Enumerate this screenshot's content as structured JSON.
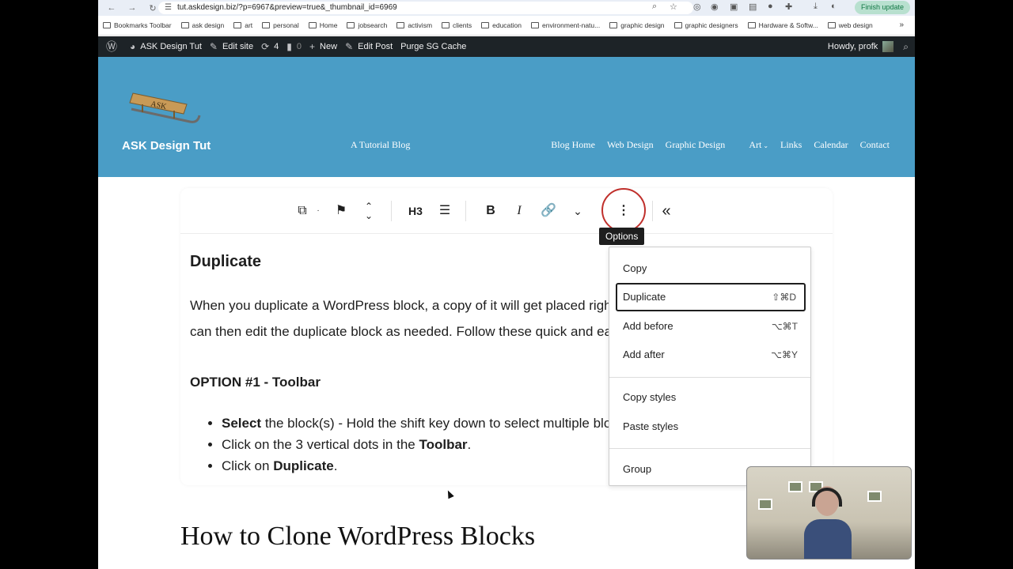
{
  "browser": {
    "url": "tut.askdesign.biz/?p=6967&preview=true&_thumbnail_id=6969",
    "finish_update": "Finish update",
    "bookmarks": [
      "Bookmarks Toolbar",
      "ask design",
      "art",
      "personal",
      "Home",
      "jobsearch",
      "activism",
      "clients",
      "education",
      "environment-natu...",
      "graphic design",
      "graphic designers",
      "Hardware & Softw...",
      "web design"
    ]
  },
  "adminbar": {
    "site": "ASK Design Tut",
    "edit_site": "Edit site",
    "updates": "4",
    "comments": "0",
    "new": "New",
    "edit_post": "Edit Post",
    "purge": "Purge SG Cache",
    "howdy": "Howdy, profk"
  },
  "header": {
    "title": "ASK Design Tut",
    "tagline": "A Tutorial Blog",
    "nav": [
      "Blog Home",
      "Web Design",
      "Graphic Design",
      "Art",
      "Links",
      "Calendar",
      "Contact"
    ]
  },
  "toolbar": {
    "heading_level": "H3",
    "tooltip": "Options"
  },
  "content": {
    "heading": "Duplicate",
    "para_line1": "When you duplicate a WordPress block, a copy of it will get placed right after the original block.",
    "para_line2": "can then edit the duplicate block as needed. Follow these quick and easy steps:",
    "option_heading": "OPTION #1 - Toolbar",
    "bullet1_bold": "Select",
    "bullet1_rest": " the block(s) - Hold the shift key down to select multiple blocks.",
    "bullet2_pre": "Click on the 3 vertical dots in the ",
    "bullet2_bold": "Toolbar",
    "bullet2_post": ".",
    "bullet3_pre": "Click on ",
    "bullet3_bold": "Duplicate",
    "bullet3_post": "."
  },
  "menu": {
    "copy": "Copy",
    "duplicate": "Duplicate",
    "duplicate_sc": "⇧⌘D",
    "add_before": "Add before",
    "add_before_sc": "⌥⌘T",
    "add_after": "Add after",
    "add_after_sc": "⌥⌘Y",
    "copy_styles": "Copy styles",
    "paste_styles": "Paste styles",
    "group": "Group"
  },
  "post_title": "How to Clone WordPress Blocks",
  "colors": {
    "header_bg": "#4a9dc6",
    "adminbar_bg": "#1d2327",
    "highlight_circle": "#c0302c"
  }
}
